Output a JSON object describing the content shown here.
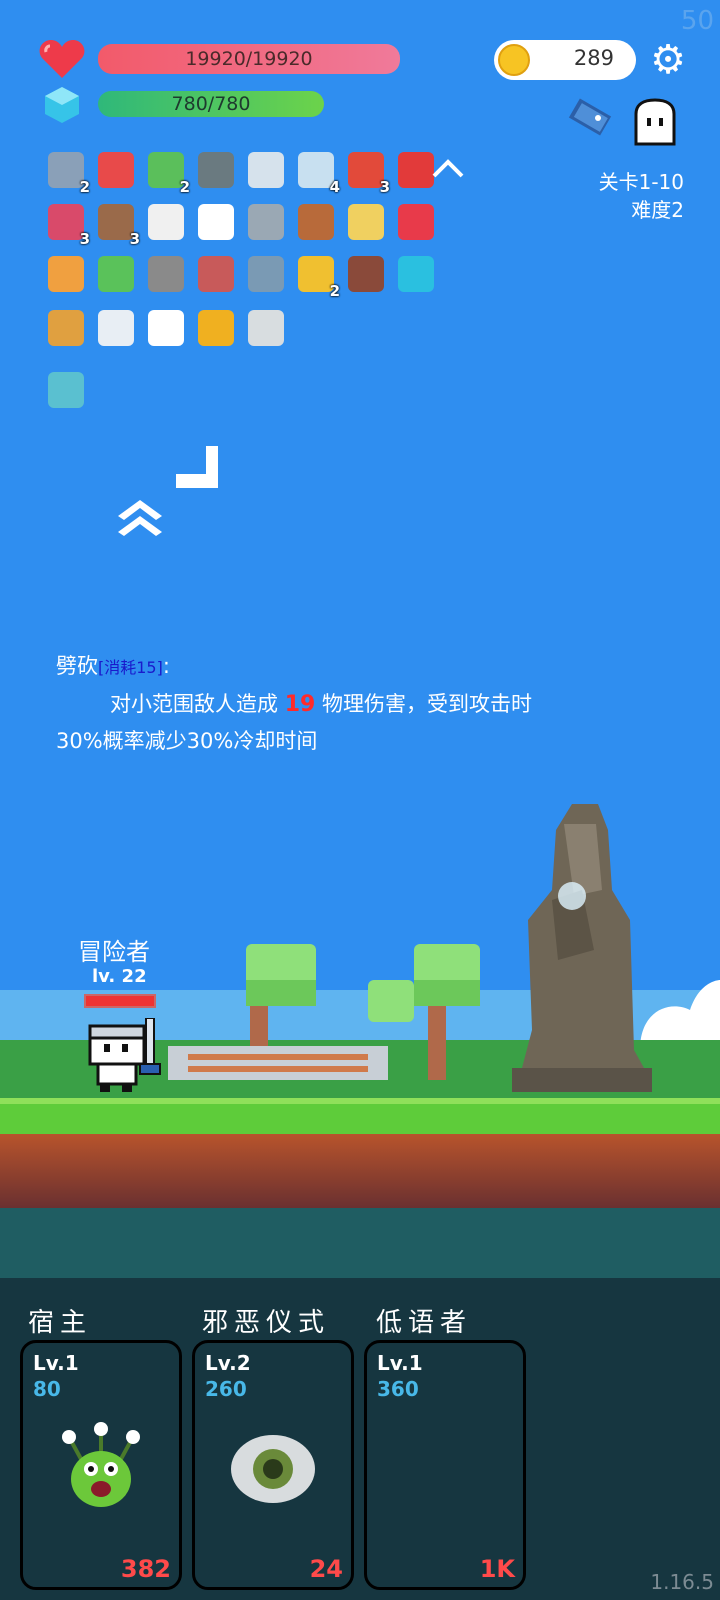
{
  "hud": {
    "fps": "50",
    "hp": "19920/19920",
    "mp": "780/780",
    "coins": "289",
    "stage": "关卡1-10",
    "difficulty": "难度2",
    "version": "1.16.5"
  },
  "inventory": [
    {
      "icon": "sword-icon",
      "count": "2",
      "color": "#8aa0b8"
    },
    {
      "icon": "watermelon-icon",
      "count": "",
      "color": "#e84a4a"
    },
    {
      "icon": "cash-heart-icon",
      "count": "2",
      "color": "#5bbf5b"
    },
    {
      "icon": "mortar-icon",
      "count": "",
      "color": "#6a7a80"
    },
    {
      "icon": "sword-icon",
      "count": "",
      "color": "#d6e2ec"
    },
    {
      "icon": "star-card-icon",
      "count": "4",
      "color": "#c8e0f0"
    },
    {
      "icon": "sock-icon",
      "count": "3",
      "color": "#e24a3a"
    },
    {
      "icon": "apple-icon",
      "count": "",
      "color": "#e23a3a"
    },
    {
      "icon": "jam-jar-icon",
      "count": "3",
      "color": "#d94a6a"
    },
    {
      "icon": "round-shield-icon",
      "count": "3",
      "color": "#9a6a4a"
    },
    {
      "icon": "checklist-icon",
      "count": "",
      "color": "#f0f0f0"
    },
    {
      "icon": "ghost-icon",
      "count": "",
      "color": "#ffffff"
    },
    {
      "icon": "axe-icon",
      "count": "",
      "color": "#9aa8b4"
    },
    {
      "icon": "meat-icon",
      "count": "",
      "color": "#b86a3a"
    },
    {
      "icon": "halo-icon",
      "count": "",
      "color": "#f0d060"
    },
    {
      "icon": "heart-icon",
      "count": "",
      "color": "#e83a4a"
    },
    {
      "icon": "scroll-icon",
      "count": "",
      "color": "#f0a040"
    },
    {
      "icon": "green-book-icon",
      "count": "",
      "color": "#5ac25a"
    },
    {
      "icon": "helmet-icon",
      "count": "",
      "color": "#8a8a8a"
    },
    {
      "icon": "hook-icon",
      "count": "",
      "color": "#c85a5a"
    },
    {
      "icon": "shield-icon",
      "count": "",
      "color": "#7a9ab4"
    },
    {
      "icon": "sun-orb-icon",
      "count": "2",
      "color": "#f0c030"
    },
    {
      "icon": "mushroom-icon",
      "count": "",
      "color": "#8a4a3a"
    },
    {
      "icon": "gem-icon",
      "count": "",
      "color": "#2ac0e0"
    },
    {
      "icon": "tome-icon",
      "count": "",
      "color": "#e0a040"
    },
    {
      "icon": "cloud-icon",
      "count": "",
      "color": "#e8eef4"
    },
    {
      "icon": "flower-icon",
      "count": "",
      "color": "#ffffff"
    },
    {
      "icon": "coin-stack-icon",
      "count": "",
      "color": "#f0b020"
    },
    {
      "icon": "briefcase-card-icon",
      "count": "",
      "color": "#d8dde0"
    },
    {
      "icon": "lightbulb-card-icon",
      "count": "",
      "color": "#5ac0d0"
    }
  ],
  "skill": {
    "name": "劈砍",
    "cost": "[消耗15]",
    "colon": ":",
    "line1_pre": "对小范围敌人造成 ",
    "damage": "19",
    "line1_post": " 物理伤害，受到攻击时",
    "line2": "30%概率减少30%冷却时间"
  },
  "hero": {
    "name": "冒险者",
    "level": "lv. 22"
  },
  "cards": [
    {
      "title": "宿主",
      "level": "Lv.1",
      "cost": "80",
      "power": "382",
      "art": "green-monster-icon"
    },
    {
      "title": "邪恶仪式",
      "level": "Lv.2",
      "cost": "260",
      "power": "24",
      "art": "eye-icon"
    },
    {
      "title": "低语者",
      "level": "Lv.1",
      "cost": "360",
      "power": "1K",
      "art": "crescent-moon-icon"
    }
  ]
}
